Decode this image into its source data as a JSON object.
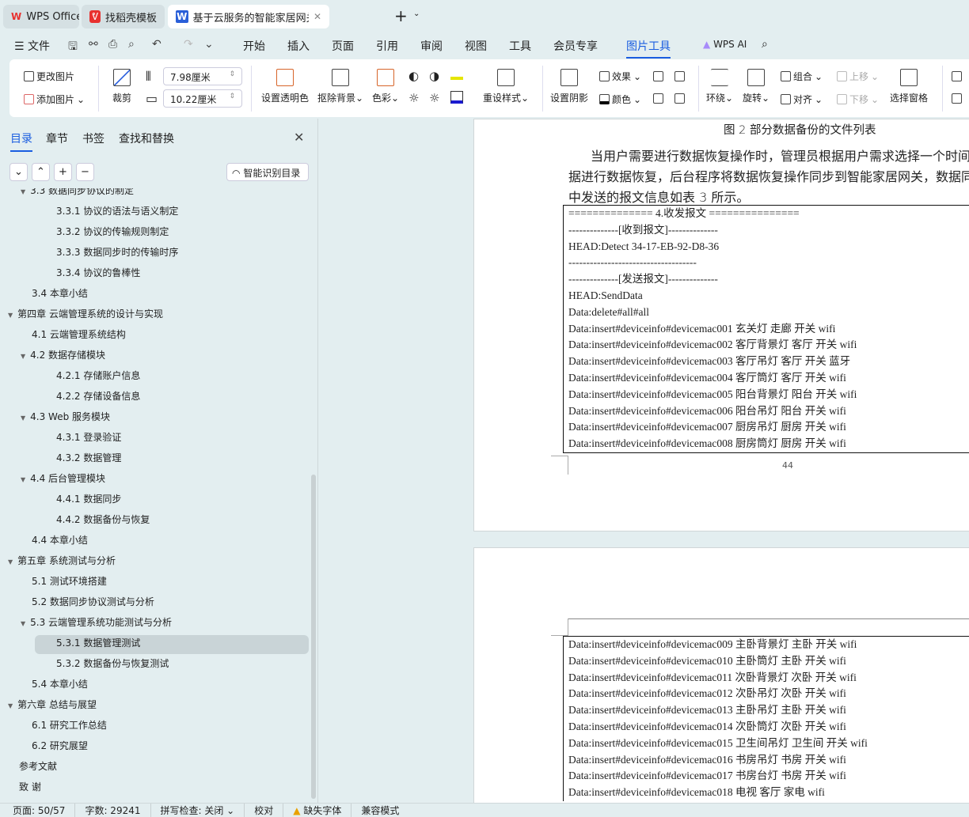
{
  "tabs": [
    {
      "label": "WPS Office",
      "icon": "wps-logo-icon"
    },
    {
      "label": "找稻壳模板",
      "icon": "docer-icon"
    },
    {
      "label": "基于云服务的智能家居网关管理",
      "icon": "writer-doc-icon"
    }
  ],
  "menu": {
    "file": "文件",
    "items": [
      "开始",
      "插入",
      "页面",
      "引用",
      "审阅",
      "视图",
      "工具",
      "会员专享",
      "图片工具"
    ],
    "active": "图片工具",
    "ai": "WPS AI"
  },
  "ribbon": {
    "change_picture": "更改图片",
    "add_picture": "添加图片",
    "crop": "裁剪",
    "height": "7.98厘米",
    "width": "10.22厘米",
    "set_transparent": "设置透明色",
    "remove_bg": "抠除背景",
    "color": "色彩",
    "reset_style": "重设样式",
    "shadow": "设置阴影",
    "effects": "效果",
    "fill_color": "颜色",
    "wrap": "环绕",
    "rotate": "旋转",
    "group": "组合",
    "align": "对齐",
    "bring_forward": "上移",
    "send_backward": "下移",
    "selection_pane": "选择窗格"
  },
  "sidebar": {
    "tabs": [
      "目录",
      "章节",
      "书签",
      "查找和替换"
    ],
    "smart_toc": "智能识别目录",
    "items": [
      {
        "label": "3.3  数据同步协议的制定",
        "level": 2,
        "expanded": true
      },
      {
        "label": "3.3.1  协议的语法与语义制定",
        "level": 3
      },
      {
        "label": "3.3.2  协议的传输规则制定",
        "level": 3
      },
      {
        "label": "3.3.3  数据同步时的传输时序",
        "level": 3
      },
      {
        "label": "3.3.4  协议的鲁棒性",
        "level": 3
      },
      {
        "label": "3.4  本章小结",
        "level": 2
      },
      {
        "label": "第四章  云端管理系统的设计与实现",
        "level": 1,
        "expanded": true
      },
      {
        "label": "4.1  云端管理系统结构",
        "level": 2
      },
      {
        "label": "4.2  数据存储模块",
        "level": 2,
        "expanded": true
      },
      {
        "label": "4.2.1  存储账户信息",
        "level": 3
      },
      {
        "label": "4.2.2  存储设备信息",
        "level": 3
      },
      {
        "label": "4.3 Web 服务模块",
        "level": 2,
        "expanded": true
      },
      {
        "label": "4.3.1  登录验证",
        "level": 3
      },
      {
        "label": "4.3.2  数据管理",
        "level": 3
      },
      {
        "label": "4.4  后台管理模块",
        "level": 2,
        "expanded": true
      },
      {
        "label": "4.4.1  数据同步",
        "level": 3
      },
      {
        "label": "4.4.2  数据备份与恢复",
        "level": 3
      },
      {
        "label": "4.4  本章小结",
        "level": 2
      },
      {
        "label": "第五章  系统测试与分析",
        "level": 1,
        "expanded": true
      },
      {
        "label": "5.1  测试环境搭建",
        "level": 2
      },
      {
        "label": "5.2  数据同步协议测试与分析",
        "level": 2
      },
      {
        "label": "5.3  云端管理系统功能测试与分析",
        "level": 2,
        "expanded": true
      },
      {
        "label": "5.3.1  数据管理测试",
        "level": 3,
        "selected": true
      },
      {
        "label": "5.3.2  数据备份与恢复测试",
        "level": 3
      },
      {
        "label": "5.4  本章小结",
        "level": 2
      },
      {
        "label": "第六章    总结与展望",
        "level": 1,
        "expanded": true
      },
      {
        "label": "6.1  研究工作总结",
        "level": 2
      },
      {
        "label": "6.2  研究展望",
        "level": 2
      },
      {
        "label": "参考文献",
        "level": 1
      },
      {
        "label": "致    谢",
        "level": 1
      }
    ]
  },
  "document": {
    "caption": "图 2 部分数据备份的文件列表",
    "para": [
      "当用户需要进行数据恢复操作时，管理员根据用户需求选择一个时间",
      "据进行数据恢复，后台程序将数据恢复操作同步到智能家居网关，数据同",
      "中发送的报文信息如表 3 所示。"
    ],
    "table1": [
      "==============    4.收发报文                   ===============",
      "--------------[收到报文]--------------",
      "HEAD:Detect 34-17-EB-92-D8-36",
      "------------------------------------",
      "--------------[发送报文]--------------",
      "HEAD:SendData",
      "Data:delete#all#all",
      "Data:insert#deviceinfo#devicemac001  玄关灯  走廊  开关  wifi",
      "Data:insert#deviceinfo#devicemac002  客厅背景灯  客厅  开关  wifi",
      "Data:insert#deviceinfo#devicemac003  客厅吊灯  客厅  开关  蓝牙",
      "Data:insert#deviceinfo#devicemac004  客厅筒灯  客厅  开关  wifi",
      "Data:insert#deviceinfo#devicemac005  阳台背景灯  阳台  开关  wifi",
      "Data:insert#deviceinfo#devicemac006  阳台吊灯  阳台  开关  wifi",
      "Data:insert#deviceinfo#devicemac007  厨房吊灯  厨房  开关  wifi",
      "Data:insert#deviceinfo#devicemac008  厨房筒灯  厨房  开关  wifi"
    ],
    "page_number": "44",
    "table2": [
      "Data:insert#deviceinfo#devicemac009  主卧背景灯  主卧  开关  wifi",
      "Data:insert#deviceinfo#devicemac010  主卧筒灯  主卧  开关  wifi",
      "Data:insert#deviceinfo#devicemac011  次卧背景灯  次卧  开关  wifi",
      "Data:insert#deviceinfo#devicemac012  次卧吊灯  次卧  开关  wifi",
      "Data:insert#deviceinfo#devicemac013  主卧吊灯  主卧  开关  wifi",
      "Data:insert#deviceinfo#devicemac014  次卧筒灯  次卧  开关  wifi",
      "Data:insert#deviceinfo#devicemac015  卫生间吊灯  卫生间  开关  wifi",
      "Data:insert#deviceinfo#devicemac016  书房吊灯  书房  开关  wifi",
      "Data:insert#deviceinfo#devicemac017  书房台灯  书房  开关  wifi",
      "Data:insert#deviceinfo#devicemac018  电视  客厅  家电  wifi"
    ]
  },
  "status": {
    "page": "页面: 50/57",
    "words": "字数: 29241",
    "spell": "拼写检查: 关闭",
    "proof": "校对",
    "missing_font": "缺失字体",
    "compat": "兼容模式"
  },
  "colors": {
    "accent": "#1a5de0",
    "wps_red": "#e8312f"
  }
}
